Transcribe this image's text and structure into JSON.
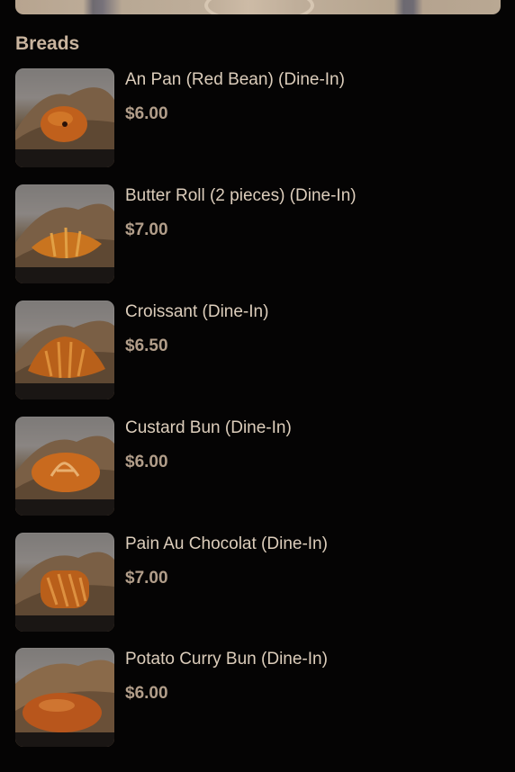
{
  "section": {
    "title": "Breads"
  },
  "items": [
    {
      "name": "An Pan (Red Bean) (Dine-In)",
      "price": "$6.00",
      "image_icon": "an-pan-bread-image"
    },
    {
      "name": "Butter Roll (2 pieces) (Dine-In)",
      "price": "$7.00",
      "image_icon": "butter-roll-bread-image"
    },
    {
      "name": "Croissant (Dine-In)",
      "price": "$6.50",
      "image_icon": "croissant-bread-image"
    },
    {
      "name": "Custard Bun (Dine-In)",
      "price": "$6.00",
      "image_icon": "custard-bun-bread-image"
    },
    {
      "name": "Pain Au Chocolat (Dine-In)",
      "price": "$7.00",
      "image_icon": "pain-au-chocolat-bread-image"
    },
    {
      "name": "Potato Curry Bun (Dine-In)",
      "price": "$6.00",
      "image_icon": "potato-curry-bun-bread-image"
    }
  ],
  "colors": {
    "background": "#050404",
    "title": "#c9b49e",
    "name": "#dccdbb",
    "price": "#b29e8a",
    "bread": "#c2651c"
  }
}
